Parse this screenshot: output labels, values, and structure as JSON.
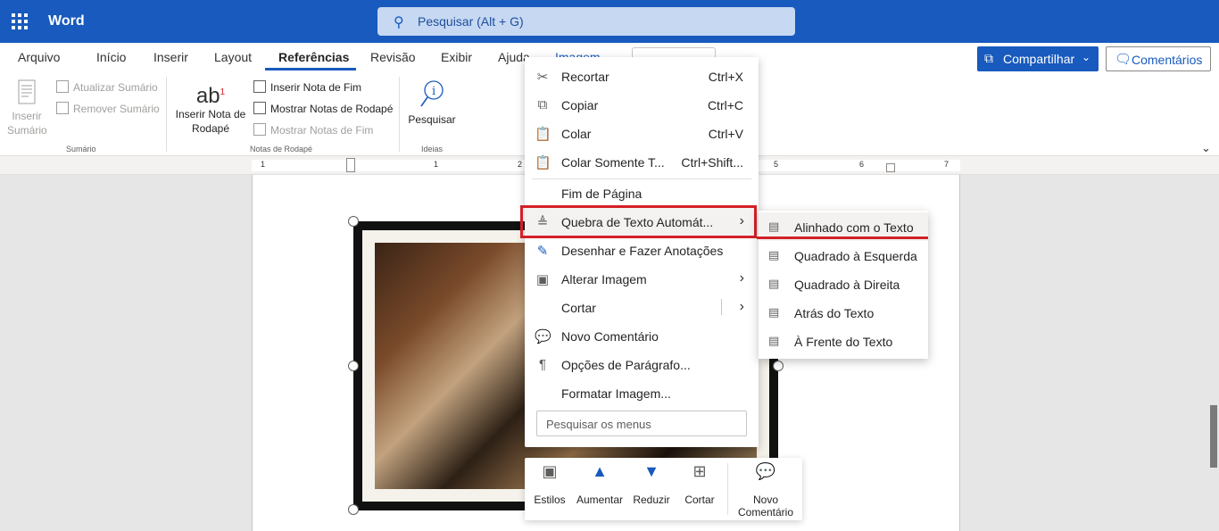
{
  "app": {
    "name": "Word"
  },
  "search": {
    "placeholder": "Pesquisar (Alt + G)"
  },
  "tabs": [
    "Arquivo",
    "Início",
    "Inserir",
    "Layout",
    "Referências",
    "Revisão",
    "Exibir",
    "Ajuda",
    "Imagem"
  ],
  "active_tab": "Referências",
  "header": {
    "share": "Compartilhar",
    "comments": "Comentários"
  },
  "ribbon": {
    "sumario": {
      "insert": "Inserir\nSumário",
      "update": "Atualizar Sumário",
      "remove": "Remover Sumário",
      "label": "Sumário"
    },
    "notas": {
      "insert_big": "Inserir Nota de Rodapé",
      "insert_end": "Inserir Nota de Fim",
      "show_footnotes": "Mostrar Notas de Rodapé",
      "show_endnotes": "Mostrar Notas de Fim",
      "label": "Notas de Rodapé"
    },
    "ideias": {
      "search": "Pesquisar",
      "label": "Ideias"
    }
  },
  "ruler": [
    "1",
    "1",
    "2",
    "5",
    "6",
    "7"
  ],
  "context_menu": {
    "items": [
      {
        "label": "Recortar",
        "shortcut": "Ctrl+X",
        "icon": "scissors-icon"
      },
      {
        "label": "Copiar",
        "shortcut": "Ctrl+C",
        "icon": "copy-icon"
      },
      {
        "label": "Colar",
        "shortcut": "Ctrl+V",
        "icon": "paste-icon"
      },
      {
        "label": "Colar Somente T...",
        "shortcut": "Ctrl+Shift...",
        "icon": "paste-text-icon"
      },
      {
        "label": "Fim de Página",
        "shortcut": "",
        "icon": ""
      },
      {
        "label": "Quebra de Texto Automát...",
        "shortcut": "",
        "icon": "wrap-text-icon"
      },
      {
        "label": "Desenhar e Fazer Anotações",
        "shortcut": "",
        "icon": "draw-icon"
      },
      {
        "label": "Alterar Imagem",
        "shortcut": "",
        "icon": "change-picture-icon"
      },
      {
        "label": "Cortar",
        "shortcut": "",
        "icon": ""
      },
      {
        "label": "Novo Comentário",
        "shortcut": "",
        "icon": "new-comment-icon"
      },
      {
        "label": "Opções de Parágrafo...",
        "shortcut": "",
        "icon": "paragraph-icon"
      },
      {
        "label": "Formatar Imagem...",
        "shortcut": "",
        "icon": ""
      }
    ],
    "search_placeholder": "Pesquisar os menus"
  },
  "submenu": {
    "items": [
      "Alinhado com o Texto",
      "Quadrado à Esquerda",
      "Quadrado à Direita",
      "Atrás do Texto",
      "À Frente do Texto"
    ]
  },
  "floating_toolbar": {
    "styles": "Estilos",
    "increase": "Aumentar",
    "decrease": "Reduzir",
    "crop": "Cortar",
    "new_comment": "Novo\nComentário"
  },
  "colors": {
    "brand": "#185abd",
    "highlight": "#d32027"
  }
}
